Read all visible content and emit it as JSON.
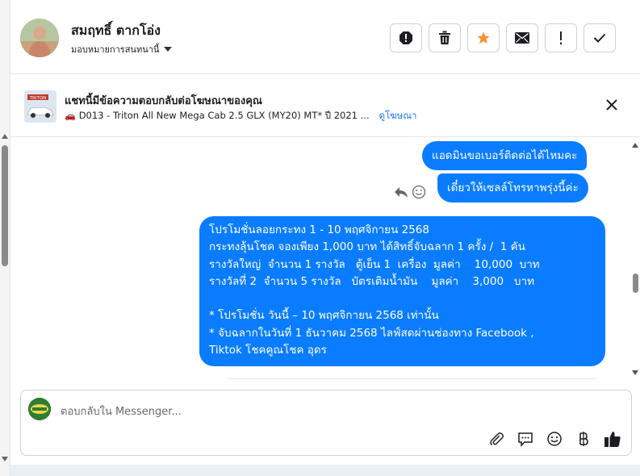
{
  "header": {
    "contact_name": "สมฤทธิ์ ตากโอ่ง",
    "assign_label": "มอบหมายการสนทนานี้",
    "actions": [
      "spam-icon",
      "trash-icon",
      "star-icon",
      "mail-icon",
      "important-icon",
      "check-icon"
    ],
    "star_color": "#f5922f"
  },
  "ad": {
    "title": "แชทนี้มีข้อความตอบกลับต่อโฆษณาของคุณ",
    "description": "D013 - Triton All New Mega Cab 2.5 GLX (MY20) MT* ปี 2021 ...",
    "link": "ดูโฆษณา",
    "thumb_text": "TRITON"
  },
  "messages": [
    {
      "text": "แอดมินขอเบอร์ติดต่อได้ไหมคะ"
    },
    {
      "text": "เดี๋ยวให้เซลล์โทรหาพรุ่งนี้ค่ะ"
    },
    {
      "lines": [
        "โปรโมชั่นลอยกระทง 1 - 10 พฤศจิกายน 2568",
        "กระทงลุ้นโชค จองเพียง 1,000 บาท ได้สิทธิ์จับฉลาก 1 ครั้ง /  1 คัน",
        "รางวัลใหญ่  จำนวน 1 รางวัล   ตู้เย็น 1  เครื่อง  มูลค่า    10,000  บาท",
        "รางวัลที่ 2  จำนวน 5 รางวัล   บัตรเติมน้ำมัน    มูลค่า    3,000   บาท",
        "",
        "* โปรโมชั่น วันนี้ – 10 พฤศจิกายน 2568 เท่านั้น",
        "* จับฉลากในวันที่ 1 ธันวาคม 2568 ไลฟ์สดผ่านช่องทาง Facebook ,",
        "Tiktok โชคคูณโชค อุดร"
      ]
    }
  ],
  "composer": {
    "placeholder": "ตอบกลับใน Messenger..."
  },
  "colors": {
    "bubble": "#0a7cff",
    "link": "#1b74e4"
  }
}
